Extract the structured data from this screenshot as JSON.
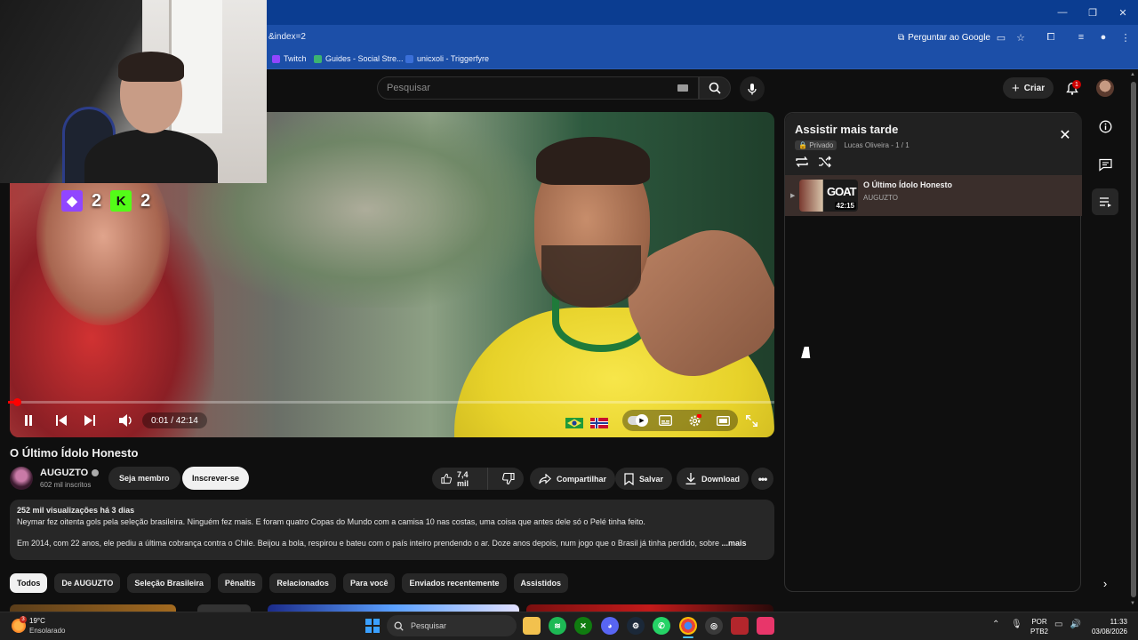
{
  "browser": {
    "url_fragment": "&index=2",
    "ask_google_label": "Perguntar ao Google",
    "bookmarks": [
      {
        "label": "Twitch",
        "color": "#9146ff"
      },
      {
        "label": "Guides - Social Stre...",
        "color": "#3cb371"
      },
      {
        "label": "unicxoli - Triggerfyre",
        "color": "#3a6fd8"
      }
    ],
    "window_controls": [
      "—",
      "❐",
      "✕"
    ]
  },
  "header": {
    "search_placeholder": "Pesquisar",
    "create_label": "Criar",
    "notification_count": "1"
  },
  "player": {
    "scoreboard": [
      {
        "logo": "twitch-logo",
        "value": "2",
        "color": "#9146ff"
      },
      {
        "logo": "kick-logo",
        "value": "2",
        "color": "#53fc18"
      }
    ],
    "current_time": "0:01",
    "duration": "42:14",
    "time_display": "0:01 / 42:14",
    "progress_fraction": 0.0004,
    "accent_color": "#ff0000"
  },
  "video": {
    "title": "O Último Ídolo Honesto",
    "channel_name": "AUGUZTO",
    "subscribers": "602 mil inscritos",
    "member_label": "Seja membro",
    "subscribe_label": "Inscrever-se",
    "like_count": "7,4 mil",
    "share_label": "Compartilhar",
    "save_label": "Salvar",
    "download_label": "Download",
    "description": {
      "meta": "252 mil visualizações  há 3 dias",
      "line1": "Neymar fez oitenta gols pela seleção brasileira. Ninguém fez mais. E foram quatro Copas do Mundo com a camisa 10 nas costas, uma coisa que antes dele só o Pelé tinha feito.",
      "line2": "Em 2014, com 22 anos, ele pediu a última cobrança contra o Chile. Beijou a bola, respirou e bateu com o país inteiro prendendo o ar. Doze anos depois, num jogo que o Brasil já tinha perdido, sobre",
      "more_label": "...mais"
    }
  },
  "chips": [
    {
      "label": "Todos",
      "active": true
    },
    {
      "label": "De AUGUZTO",
      "active": false
    },
    {
      "label": "Seleção Brasileira",
      "active": false
    },
    {
      "label": "Pênaltis",
      "active": false
    },
    {
      "label": "Relacionados",
      "active": false
    },
    {
      "label": "Para você",
      "active": false
    },
    {
      "label": "Enviados recentemente",
      "active": false
    },
    {
      "label": "Assistidos",
      "active": false
    }
  ],
  "playlist": {
    "title": "Assistir mais tarde",
    "privacy": "Privado",
    "owner_position": "Lucas Oliveira - 1 / 1",
    "items": [
      {
        "title": "O Último Ídolo Honesto",
        "channel": "AUGUZTO",
        "duration": "42:15",
        "thumb_text": "GOAT"
      }
    ]
  },
  "taskbar": {
    "weather_temp": "19°C",
    "weather_desc": "Ensolarado",
    "weather_badge": "3",
    "search_label": "Pesquisar",
    "lang_line1": "POR",
    "lang_line2": "PTB2",
    "time": "11:33",
    "date": "03/08/2026"
  }
}
